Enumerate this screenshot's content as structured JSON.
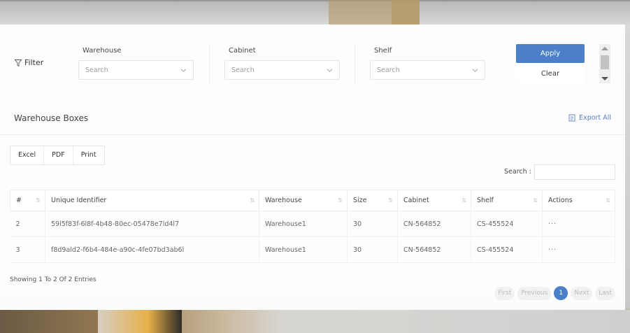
{
  "filter": {
    "label": "Filter",
    "warehouse": {
      "label": "Warehouse",
      "placeholder": "Search"
    },
    "cabinet": {
      "label": "Cabinet",
      "placeholder": "Search"
    },
    "shelf": {
      "label": "Shelf",
      "placeholder": "Search"
    },
    "apply_label": "Apply",
    "clear_label": "Clear"
  },
  "section": {
    "title": "Warehouse Boxes",
    "export_label": "Export All"
  },
  "buttons": {
    "excel": "Excel",
    "pdf": "PDF",
    "print": "Print"
  },
  "search_label": "Search :",
  "table": {
    "headers": [
      "#",
      "Unique Identifier",
      "Warehouse",
      "Size",
      "Cabinet",
      "Shelf",
      "Actions"
    ],
    "rows": [
      [
        "2",
        "59l5f83f-6l8f-4b48-80ec-05478e7ld4l7",
        "Warehouse1",
        "30",
        "CN-564852",
        "CS-455524",
        "···"
      ],
      [
        "3",
        "f8d9ald2-f6b4-484e-a90c-4fe07bd3ab6l",
        "Warehouse1",
        "30",
        "CN-564852",
        "CS-455524",
        "···"
      ]
    ]
  },
  "showing": "Showing 1 To 2 Of 2 Entries",
  "pager": {
    "first": "First",
    "previous": "Previous",
    "current": "1",
    "next": "Next",
    "last": "Last"
  },
  "colors": {
    "accent": "#4b7fc8"
  },
  "icons": {
    "filter": "filter-icon",
    "chevron": "chevron-down-icon",
    "export": "export-icon"
  }
}
